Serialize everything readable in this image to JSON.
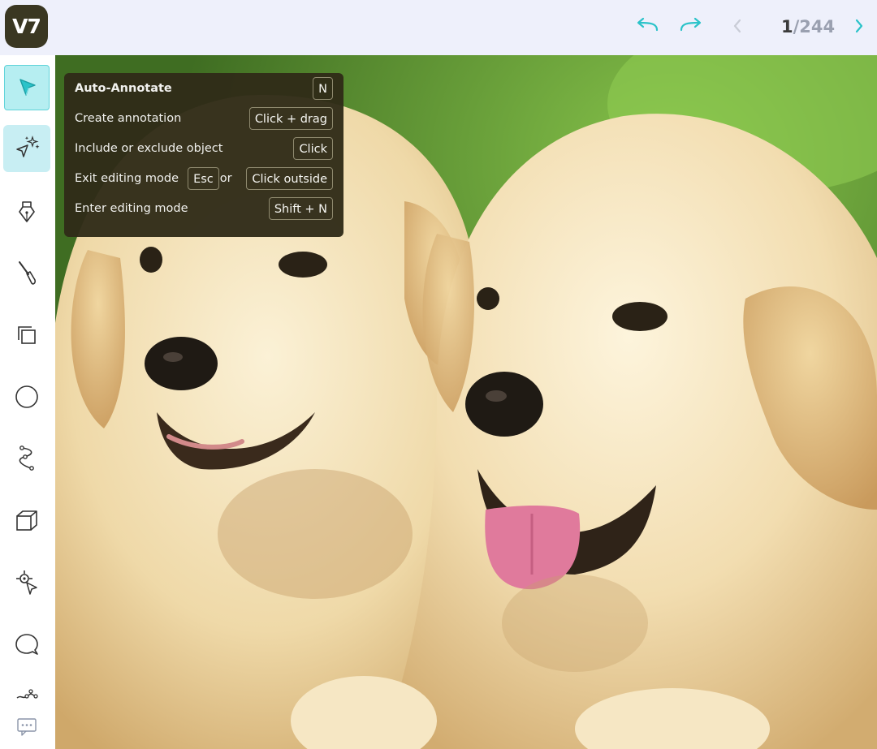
{
  "app": {
    "logo_text": "V7"
  },
  "header": {
    "undo_icon": "undo-arrow-icon",
    "redo_icon": "redo-arrow-icon",
    "prev_icon": "chevron-left-icon",
    "next_icon": "chevron-right-icon",
    "page_current": "1",
    "page_total": "/244"
  },
  "sidebar": {
    "tools": [
      {
        "name": "select-tool",
        "icon": "cursor-arrow-icon",
        "active": true
      },
      {
        "name": "auto-annotate-tool",
        "icon": "sparkle-cursor-icon",
        "active": true
      },
      {
        "name": "polygon-tool",
        "icon": "pen-nib-icon"
      },
      {
        "name": "brush-tool",
        "icon": "brush-icon"
      },
      {
        "name": "bounding-box-tool",
        "icon": "copy-squares-icon"
      },
      {
        "name": "ellipse-tool",
        "icon": "circle-icon"
      },
      {
        "name": "polyline-tool",
        "icon": "polyline-icon"
      },
      {
        "name": "cuboid-tool",
        "icon": "cube-icon"
      },
      {
        "name": "keypoint-tool",
        "icon": "keypoint-icon"
      },
      {
        "name": "comment-tool",
        "icon": "speech-bubble-icon"
      },
      {
        "name": "skeleton-tool",
        "icon": "skeleton-icon"
      },
      {
        "name": "text-tool",
        "icon": "chat-dots-icon"
      }
    ]
  },
  "tooltip": {
    "title": "Auto-Annotate",
    "title_key": "N",
    "rows": [
      {
        "label": "Create annotation",
        "key": "Click + drag"
      },
      {
        "label": "Include or exclude object",
        "key": "Click"
      },
      {
        "label": "Exit editing mode",
        "key": "Esc",
        "or": "or",
        "key2": "Click outside"
      },
      {
        "label": "Enter editing mode",
        "key": "Shift + N"
      }
    ]
  },
  "colors": {
    "accent": "#2bc3c9",
    "logo_bg": "#3a3722",
    "header_bg": "#eef0fb",
    "tooltip_bg": "#302c18"
  }
}
